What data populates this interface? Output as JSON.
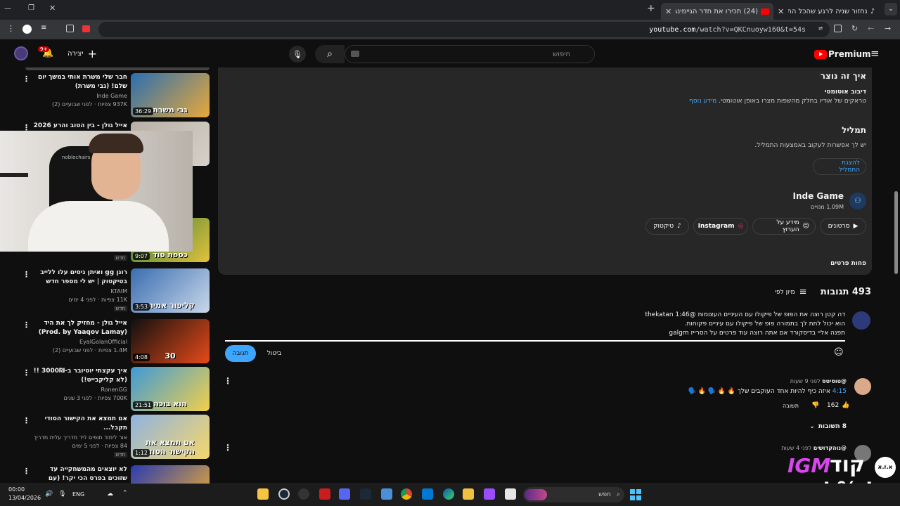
{
  "browser": {
    "tabs": [
      {
        "label": "נחזור שניה לרגע שהכל התחיל?"
      },
      {
        "label": "(24) תכירו את חדר הגיימינג הח"
      }
    ],
    "url_host": "youtube.com",
    "url_path": "/watch?v=QKCnuoyw160&t=54s"
  },
  "header": {
    "search_placeholder": "חיפוש",
    "create_label": "יצירה",
    "notif_count": "9+",
    "logo_text": "Premium"
  },
  "description": {
    "how_made_title": "איך זה נוצר",
    "auto_dub_title": "דיבוב אוטומטי",
    "auto_dub_text": "טראקים של אודיו בחלק מהשפות מצרו באופן אוטומטי.",
    "more_info": "מידע נוסף",
    "transcript_title": "תמליל",
    "transcript_text": "יש לך אפשרות לעקוב באמצעות התמליל.",
    "transcript_button": "להצגת התמליל",
    "channel_name": "Inde Game",
    "subscribers": "1.09M מנויים",
    "buttons": [
      "סרטונים",
      "מידע על הערוץ",
      "Instagram",
      "טיקטוק"
    ],
    "less": "פחות פרטים"
  },
  "comments": {
    "count_title": "493 תגובות",
    "sort_label": "מיון לפי",
    "draft_line1": "דה קטן רוצה את הפופ של פיקולו עם העיניים העצומות @thekatan 1:46",
    "draft_line2": "הוא יכול לתת לך בתמורה פופ של פיקולו עם עיניים פקוחות.",
    "draft_line3": "תפנה אליי בדיסקורד אם אתה רוצה עוד פרטים על הסרייז galgm",
    "reply_btn": "תגובה",
    "cancel_btn": "ביטול",
    "c1_author": "@טוסיטס",
    "c1_time": "לפני 9 שעות",
    "c1_ts": "4:15",
    "c1_text": "איזה כיף להיות אחד העוקבים שלך",
    "c1_emoji": "🔥 🔥 🗣️ 🔥 🗣️",
    "c1_likes": "162",
    "c1_reply": "תשובה",
    "c1_replies": "8 תשובות",
    "c2_author": "@נוהקדושים",
    "c2_time": "לפני 4 שעות"
  },
  "sidebar": {
    "videos": [
      {
        "title": "חבר שלי משרת אותי במשך יום שלם! (גבי משרת)",
        "channel": "Inde Game",
        "meta": "937K צפיות · לפני שבועיים (2)",
        "dur": "36:29",
        "thumb_text": "גבי משרת",
        "c1": "#2a6fb0",
        "c2": "#e9a838"
      },
      {
        "title": "אייל גולן - בין הטוב והרע 2026",
        "channel": "",
        "meta": "",
        "dur": "",
        "thumb_text": "",
        "c1": "#b8b0a6",
        "c2": "#d6d0c8"
      },
      {
        "title": "",
        "channel": "",
        "meta": "צפיות · לפני",
        "dur": "9:07",
        "thumb_text": "כספת סוד",
        "c1": "#2c7a3a",
        "c2": "#e3c23a",
        "badge": "חדש"
      },
      {
        "title": "רונן gg ואיתן ניסים עלו ללייב בטיקטוק | יש לי מספר חדש",
        "channel": "KTAIM",
        "meta": "11K צפיות · לפני 4 ימים",
        "dur": "3:53",
        "thumb_text": "קליפור אמיתי",
        "c1": "#3a6db0",
        "c2": "#c9d8ea",
        "badge": "חדש"
      },
      {
        "title": "אייל גולן - מחזיק לך את היד (Prod. by Yaaqov Lamay)",
        "channel": "EyalGolanOfficial",
        "meta": "1.4M צפיות · לפני שבועיים (2)",
        "dur": "4:08",
        "thumb_text": "30",
        "c1": "#101010",
        "c2": "#e64a19"
      },
      {
        "title": "איך עקצתי יוטיובר ב-3000₪ !! (לא קליקבייט!)",
        "channel": "RonenGG",
        "meta": "700K צפיות · לפני 3 שנים",
        "dur": "21:51",
        "thumb_text": "הוא בוכה",
        "c1": "#3d9ad8",
        "c2": "#f2d04a"
      },
      {
        "title": "אם תמצא את הקישור הסודי תקבל...",
        "channel": "אור לימוד תופים ליד מדריך עלית מדריך",
        "meta": "84 צפיות · לפני 5 ימים",
        "dur": "1:12",
        "thumb_text": "אם תמצא את הקישור הסודי",
        "c1": "#8fb3e0",
        "c2": "#f5d66a",
        "badge": "חדש"
      },
      {
        "title": "לא יוצאים מהמשחקייה עד שזוכים בפרס הכי יקר! (עם הגמבים)",
        "channel": "",
        "meta": "",
        "dur": "",
        "thumb_text": "",
        "c1": "#2a3bb0",
        "c2": "#f0b030"
      }
    ]
  },
  "overlay": {
    "cam_brand": "noblechairs",
    "promo_code_label": "קוד",
    "promo_code": "IGM",
    "promo_line2": "ל-%ל הנחה",
    "promo_badge": "א.ז.א"
  },
  "taskbar": {
    "time": "00:00",
    "date": "13/04/2026",
    "lang": "ENG",
    "search": "חפש"
  }
}
